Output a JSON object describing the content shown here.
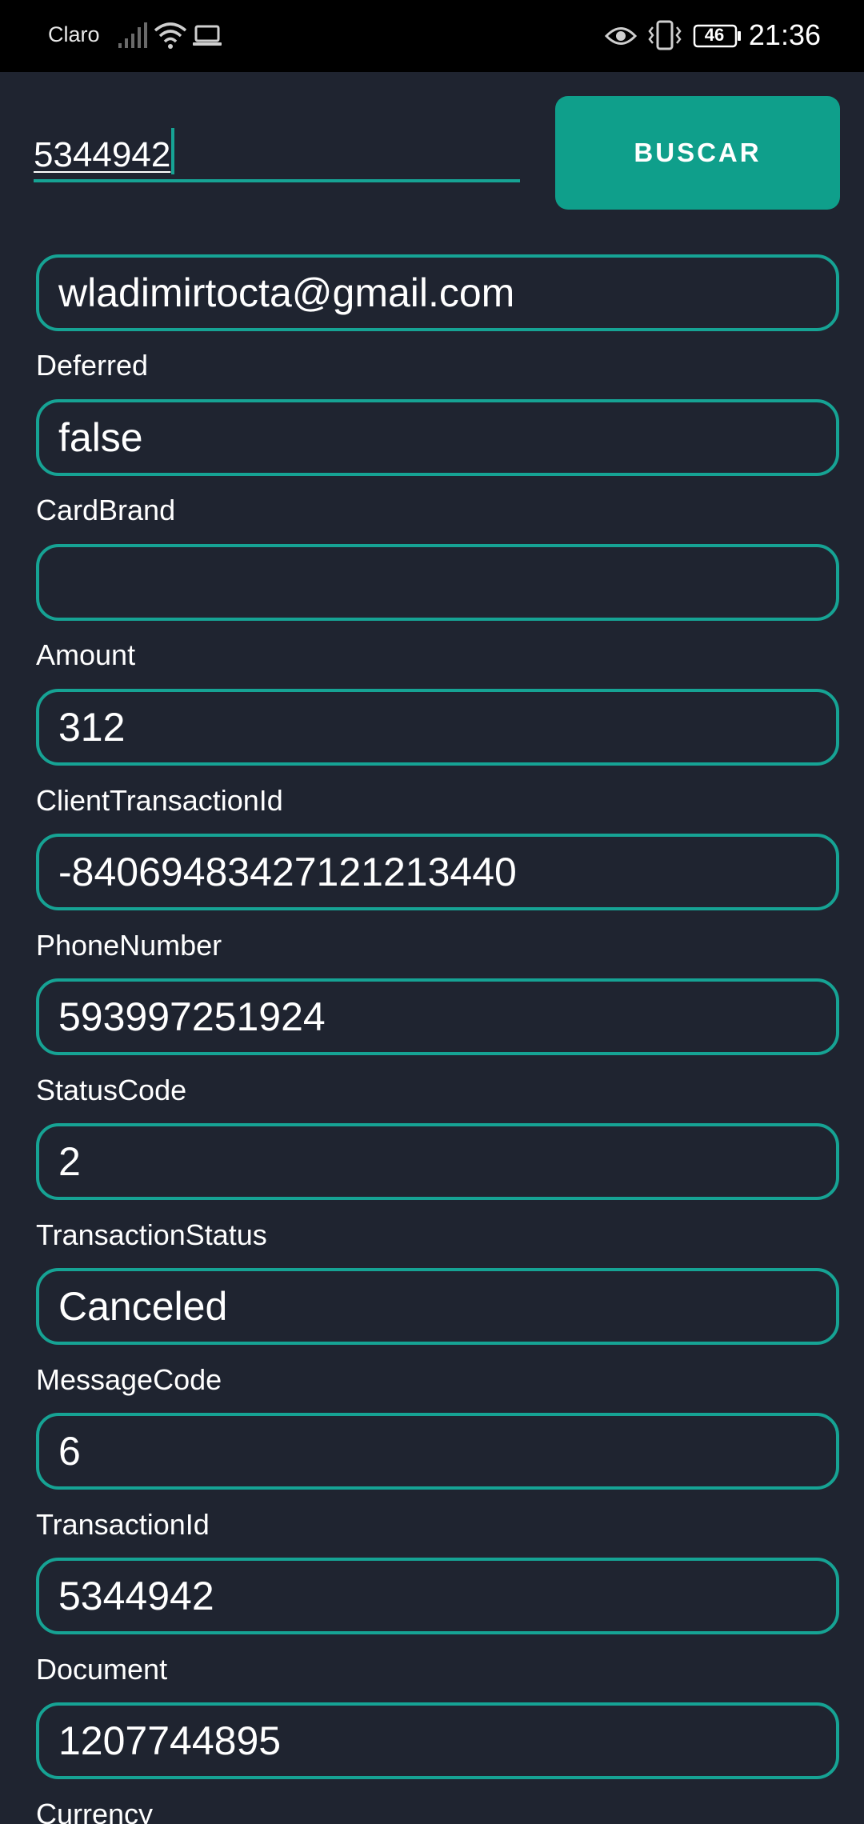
{
  "status_bar": {
    "carrier": "Claro",
    "battery": "46",
    "time": "21:36",
    "icons": [
      "signal-icon",
      "wifi-icon",
      "laptop-icon",
      "eye-icon",
      "vibrate-icon",
      "battery-icon"
    ]
  },
  "search": {
    "value": "5344942",
    "button_label": "BUSCAR"
  },
  "fields": {
    "email": {
      "value": "wladimirtocta@gmail.com"
    },
    "deferred": {
      "label": "Deferred",
      "value": "false"
    },
    "card_brand": {
      "label": "CardBrand",
      "value": ""
    },
    "amount": {
      "label": "Amount",
      "value": "312"
    },
    "client_transaction_id": {
      "label": "ClientTransactionId",
      "value": "-84069483427121213440"
    },
    "phone_number": {
      "label": "PhoneNumber",
      "value": "593997251924"
    },
    "status_code": {
      "label": "StatusCode",
      "value": "2"
    },
    "transaction_status": {
      "label": "TransactionStatus",
      "value": "Canceled"
    },
    "message_code": {
      "label": "MessageCode",
      "value": "6"
    },
    "transaction_id": {
      "label": "TransactionId",
      "value": "5344942"
    },
    "document": {
      "label": "Document",
      "value": "1207744895"
    },
    "currency": {
      "label": "Currency"
    }
  },
  "colors": {
    "background": "#1f2430",
    "accent": "#16a394",
    "button": "#0f9f8b",
    "status_bar": "#000000"
  }
}
